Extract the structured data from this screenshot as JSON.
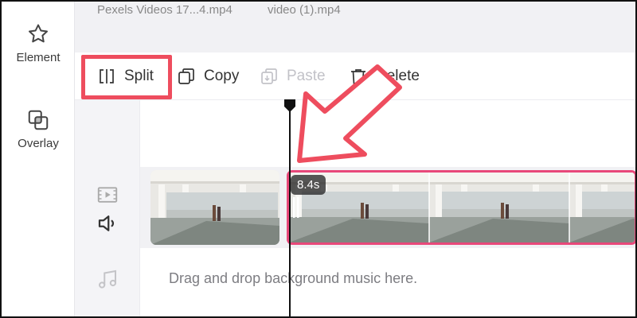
{
  "nav": {
    "element_label": "Element",
    "overlay_label": "Overlay"
  },
  "media": {
    "items": [
      "Pexels Videos 17...4.mp4",
      "video (1).mp4"
    ]
  },
  "toolbar": {
    "split_label": "Split",
    "copy_label": "Copy",
    "paste_label": "Paste",
    "delete_label": "Delete",
    "paste_enabled": false
  },
  "timeline": {
    "selected_clip_duration": "8.4s",
    "music_hint": "Drag and drop background music here."
  },
  "colors": {
    "highlight": "#ee4d5e",
    "selected_clip_border": "#e8487a",
    "annotation_arrow": "#ee4d5e"
  }
}
